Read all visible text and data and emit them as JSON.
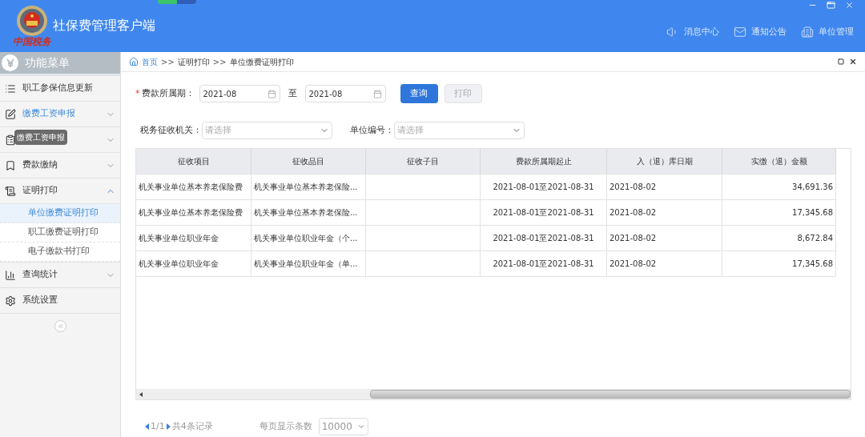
{
  "header": {
    "title": "社保费管理客户端",
    "logo_caption": "中国税务",
    "links": [
      {
        "kind": "speaker",
        "label": "消息中心"
      },
      {
        "kind": "mail",
        "label": "通知公告"
      },
      {
        "kind": "building",
        "label": "单位管理"
      }
    ]
  },
  "sidebar": {
    "title": "功能菜单",
    "items": [
      {
        "kind": "list",
        "label": "职工参保信息更新",
        "active": false
      },
      {
        "kind": "edit",
        "label": "缴费工资申报",
        "active": true,
        "expanded": false
      },
      {
        "kind": "clipboard",
        "expanded": false
      },
      {
        "kind": "bookmark",
        "label": "费款缴纳",
        "active": false,
        "expanded": false
      },
      {
        "kind": "doc",
        "label": "证明打印",
        "active": false,
        "expanded": true,
        "children": [
          {
            "label": "单位缴费证明打印",
            "selected": true
          },
          {
            "label": "职工缴费证明打印",
            "selected": false
          },
          {
            "label": "电子缴款书打印",
            "selected": false
          }
        ]
      },
      {
        "kind": "chart",
        "label": "查询统计",
        "active": false,
        "expanded": false
      },
      {
        "kind": "gear",
        "label": "系统设置",
        "active": false
      }
    ],
    "tooltip": "缴费工资申报"
  },
  "breadcrumb": [
    "首页",
    "证明打印",
    "单位缴费证明打印"
  ],
  "breadcrumb_separator": ">>",
  "form": {
    "period_label": "费款所属期：",
    "required_mark": "*",
    "from": "2021-08",
    "to_label": "至",
    "to": "2021-08",
    "query_button": "查询",
    "print_button": {
      "label": "打印",
      "disabled": true
    },
    "tax_office": {
      "label": "税务征收机关：",
      "placeholder": "请选择"
    },
    "unit_number": {
      "label": "单位编号：",
      "placeholder": "请选择"
    }
  },
  "table": {
    "columns": [
      "征收项目",
      "征收品目",
      "征收子目",
      "费款所属期起止",
      "入（退）库日期",
      "实缴（退）金额"
    ],
    "rows": [
      [
        "机关事业单位基本养老保险费",
        "机关事业单位基本养老保险...",
        "",
        "2021-08-01至2021-08-31",
        "2021-08-02",
        "34,691.36"
      ],
      [
        "机关事业单位基本养老保险费",
        "机关事业单位基本养老保险...",
        "",
        "2021-08-01至2021-08-31",
        "2021-08-02",
        "17,345.68"
      ],
      [
        "机关事业单位职业年金",
        "机关事业单位职业年金（个...",
        "",
        "2021-08-01至2021-08-31",
        "2021-08-02",
        "8,672.84"
      ],
      [
        "机关事业单位职业年金",
        "机关事业单位职业年金（单...",
        "",
        "2021-08-01至2021-08-31",
        "2021-08-02",
        "17,345.68"
      ]
    ]
  },
  "pagination": {
    "page": "1/1",
    "total": "共4条记录",
    "page_size_label": "每页显示条数",
    "page_size": "10000"
  }
}
